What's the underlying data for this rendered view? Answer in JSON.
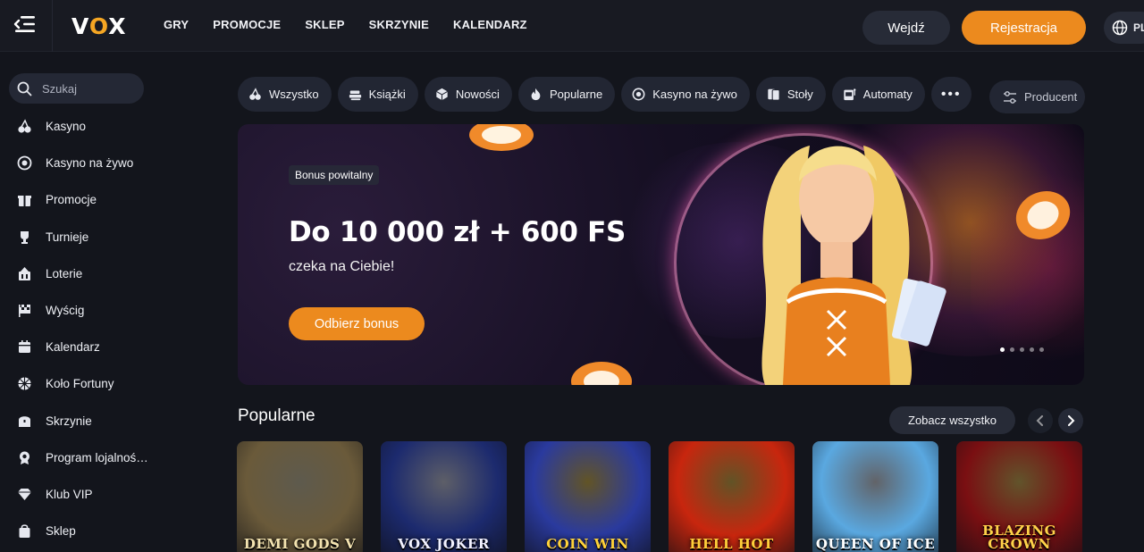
{
  "header": {
    "logo": "VOX",
    "nav": [
      "GRY",
      "PROMOCJE",
      "SKLEP",
      "SKRZYNIE",
      "KALENDARZ"
    ],
    "login_label": "Wejdź",
    "register_label": "Rejestracja",
    "language": "PL"
  },
  "sidebar": {
    "search_placeholder": "Szukaj",
    "items": [
      {
        "label": "Kasyno",
        "icon": "cherries-icon"
      },
      {
        "label": "Kasyno na żywo",
        "icon": "chip-icon"
      },
      {
        "label": "Promocje",
        "icon": "gift-icon"
      },
      {
        "label": "Turnieje",
        "icon": "trophy-icon"
      },
      {
        "label": "Loterie",
        "icon": "lottery-icon"
      },
      {
        "label": "Wyścig",
        "icon": "race-flag-icon"
      },
      {
        "label": "Kalendarz",
        "icon": "calendar-icon"
      },
      {
        "label": "Koło Fortuny",
        "icon": "wheel-icon"
      },
      {
        "label": "Skrzynie",
        "icon": "chest-icon"
      },
      {
        "label": "Program lojalności...",
        "icon": "loyalty-icon"
      },
      {
        "label": "Klub VIP",
        "icon": "diamond-icon"
      },
      {
        "label": "Sklep",
        "icon": "shop-bag-icon"
      }
    ]
  },
  "categories": [
    {
      "label": "Wszystko",
      "icon": "cherries-icon"
    },
    {
      "label": "Książki",
      "icon": "books-icon"
    },
    {
      "label": "Nowości",
      "icon": "new-cube-icon"
    },
    {
      "label": "Popularne",
      "icon": "fire-icon"
    },
    {
      "label": "Kasyno na żywo",
      "icon": "chip-icon"
    },
    {
      "label": "Stoły",
      "icon": "cards-icon"
    },
    {
      "label": "Automaty",
      "icon": "slot-machine-icon"
    }
  ],
  "more_label": "•••",
  "producer_label": "Producent",
  "banner": {
    "badge": "Bonus powitalny",
    "title": "Do 10 000 zł + 600 FS",
    "subtitle": "czeka na Ciebie!",
    "cta": "Odbierz bonus",
    "slides_total": 5,
    "slide_active": 1
  },
  "popular": {
    "title": "Popularne",
    "see_all": "Zobacz wszystko",
    "games": [
      {
        "name": "DEMI GODS V",
        "bg": "#6a5a3a",
        "fg": "#f3e3b0"
      },
      {
        "name": "VOX JOKER",
        "bg": "#1c2a6e",
        "fg": "#f2f2ff"
      },
      {
        "name": "COIN WIN",
        "bg": "#2a3a9e",
        "fg": "#ffd23a"
      },
      {
        "name": "HELL HOT",
        "bg": "#c8260e",
        "fg": "#ffcf3a"
      },
      {
        "name": "QUEEN OF ICE",
        "bg": "#5aa8e0",
        "fg": "#ffffff"
      },
      {
        "name": "BLAZING CROWN",
        "bg": "#7a0f12",
        "fg": "#ffd24a"
      }
    ]
  },
  "colors": {
    "accent": "#ec8a1e",
    "background": "#13151c",
    "chip": "#222633"
  }
}
